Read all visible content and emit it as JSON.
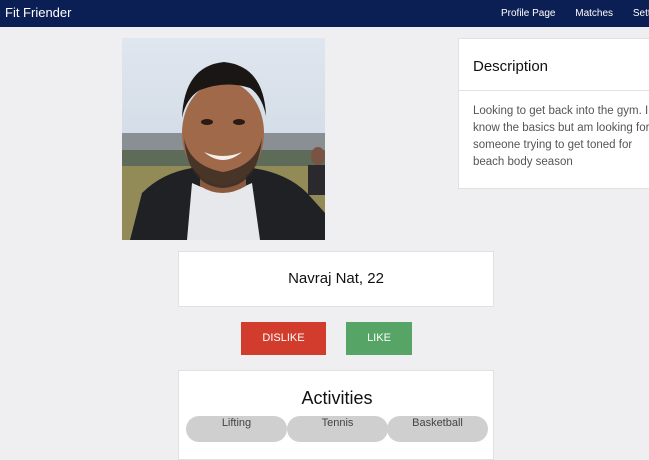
{
  "navbar": {
    "brand": "Fit Friender",
    "links": [
      "Profile Page",
      "Matches",
      "Settings"
    ]
  },
  "description": {
    "title": "Description",
    "text": "Looking to get back into the gym. I know the basics but am looking for someone trying to get toned for beach body season"
  },
  "profile": {
    "name_age": "Navraj Nat, 22",
    "photo_alt": "profile photo"
  },
  "actions": {
    "dislike_label": "DISLIKE",
    "like_label": "LIKE",
    "dislike_color": "#d23c2c",
    "like_color": "#56a566"
  },
  "activities": {
    "title": "Activities",
    "items": [
      "Lifting",
      "Tennis",
      "Basketball"
    ]
  },
  "colors": {
    "navbar": "#0c1f55",
    "background": "#efeff2"
  }
}
